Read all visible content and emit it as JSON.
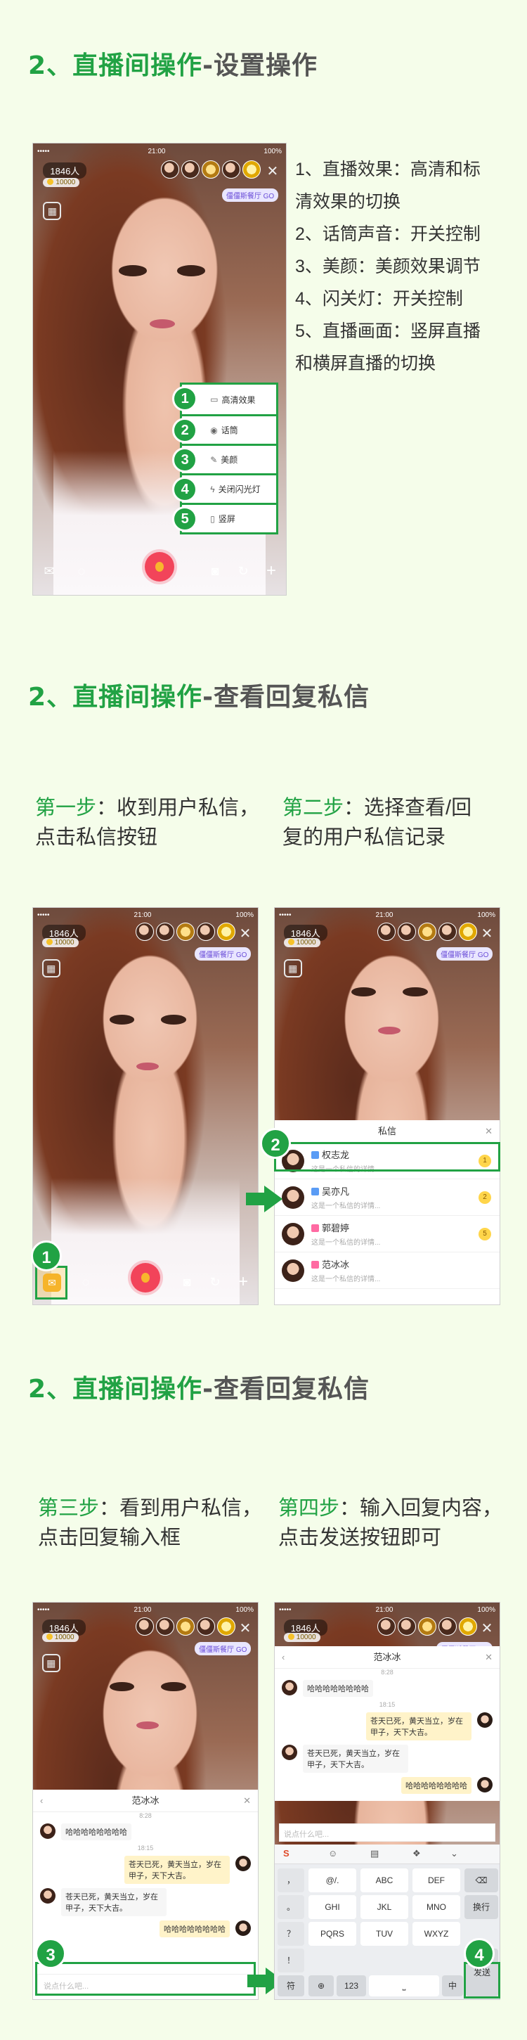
{
  "section1": {
    "num": "2、",
    "main": "直播间操作",
    "sub": "-设置操作"
  },
  "section2": {
    "num": "2、",
    "main": "直播间操作",
    "sub": "-查看回复私信"
  },
  "section3": {
    "num": "2、",
    "main": "直播间操作",
    "sub": "-查看回复私信"
  },
  "phone_common": {
    "time": "21:00",
    "battery": "100%",
    "carrier": "•••••",
    "viewers": "1846人",
    "coins": "10000",
    "hall": "僵僵斯餐厅 GO"
  },
  "settings_menu": [
    {
      "num": "1",
      "label": "高清效果",
      "icon": "hd-icon"
    },
    {
      "num": "2",
      "label": "话筒",
      "icon": "mic-icon"
    },
    {
      "num": "3",
      "label": "美颜",
      "icon": "beauty-icon"
    },
    {
      "num": "4",
      "label": "关闭闪光灯",
      "icon": "flash-icon"
    },
    {
      "num": "5",
      "label": "竖屏",
      "icon": "portrait-icon"
    }
  ],
  "settings_desc": [
    "1、直播效果：高清和标",
    "清效果的切换",
    "2、话筒声音：开关控制",
    "3、美颜：美颜效果调节",
    "4、闪关灯：开关控制",
    "5、直播画面：竖屏直播",
    "和横屏直播的切换"
  ],
  "steps": {
    "s1_label": "第一步",
    "s1_text_a": "：收到用户私信，",
    "s1_text_b": "点击私信按钮",
    "s2_label": "第二步",
    "s2_text_a": "：选择查看/回",
    "s2_text_b": "复的用户私信记录",
    "s3_label": "第三步",
    "s3_text_a": "：看到用户私信，",
    "s3_text_b": "点击回复输入框",
    "s4_label": "第四步",
    "s4_text_a": "：输入回复内容，",
    "s4_text_b": "点击发送按钮即可"
  },
  "private_messages": {
    "title": "私信",
    "items": [
      {
        "name": "权志龙",
        "preview": "这是一个私信的详情...",
        "count": "1",
        "tag": "blue"
      },
      {
        "name": "吴亦凡",
        "preview": "这是一个私信的详情...",
        "count": "2",
        "tag": "blue"
      },
      {
        "name": "郭碧婷",
        "preview": "这是一个私信的详情...",
        "count": "5",
        "tag": "pink"
      },
      {
        "name": "范冰冰",
        "preview": "这是一个私信的详情...",
        "count": "",
        "tag": "pink"
      }
    ]
  },
  "chat": {
    "title": "范冰冰",
    "t1": "8:28",
    "m1": "哈哈哈哈哈哈哈哈",
    "t2": "18:15",
    "m2": "苍天已死，黄天当立，岁在甲子，天下大吉。",
    "m3": "苍天已死，黄天当立，岁在甲子，天下大吉。",
    "m4": "哈哈哈哈哈哈哈哈",
    "placeholder": "说点什么吧..."
  },
  "keyboard": {
    "r1": [
      "@/.",
      "ABC",
      "DEF"
    ],
    "r2": [
      "GHI",
      "JKL",
      "MNO"
    ],
    "r3": [
      "PQRS",
      "TUV",
      "WXYZ"
    ],
    "side_left": [
      "，",
      "。",
      "？",
      "！"
    ],
    "wrap": "换行",
    "fu": "符",
    "num": "123",
    "zh": "中",
    "send": "发送"
  },
  "badges": {
    "b1": "1",
    "b2": "2",
    "b3": "3",
    "b4": "4"
  },
  "accent_color": "#21a244"
}
